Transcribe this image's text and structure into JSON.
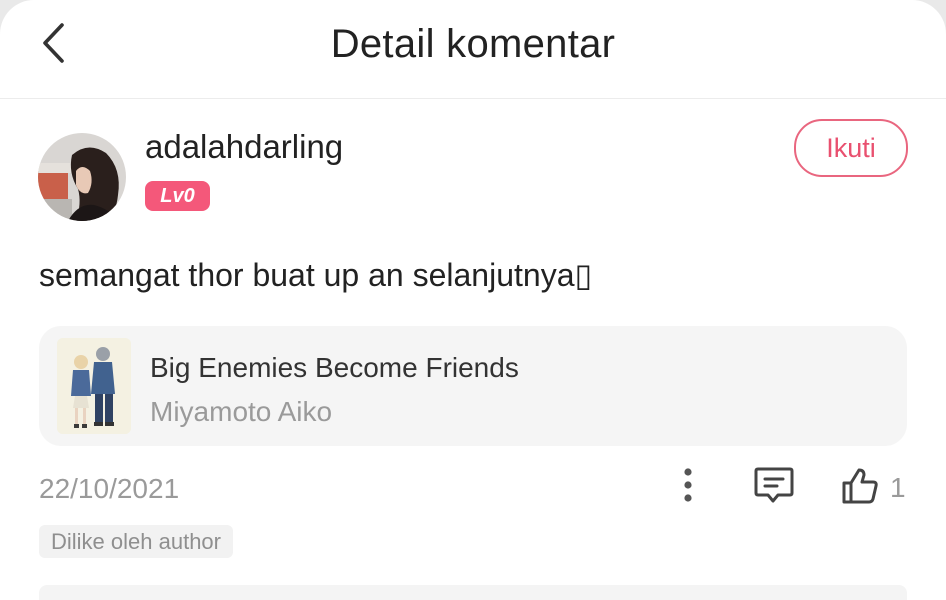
{
  "header": {
    "title": "Detail komentar",
    "back_icon": "chevron-left-icon"
  },
  "comment": {
    "username": "adalahdarling",
    "level": "Lv0",
    "follow_label": "Ikuti",
    "text": "semangat thor buat up an selanjutnya▯",
    "date": "22/10/2021",
    "like_count": "1",
    "author_like_tag": "Dilike oleh author"
  },
  "book": {
    "title": "Big Enemies Become Friends",
    "author": "Miyamoto Aiko"
  },
  "colors": {
    "accent": "#f4587a",
    "follow_border": "#e9667f",
    "muted_text": "#9a9a9a"
  },
  "icons": {
    "more": "more-vertical-icon",
    "reply": "comment-icon",
    "like": "thumbs-up-icon"
  }
}
